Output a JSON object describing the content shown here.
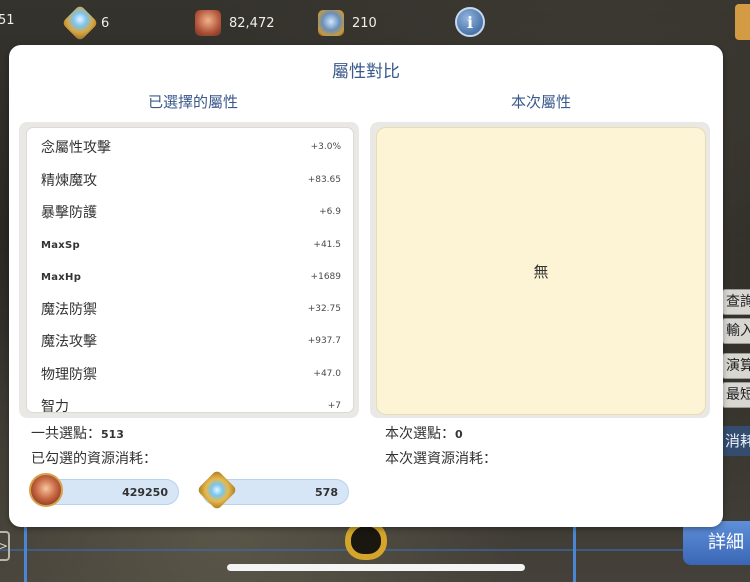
{
  "hud": {
    "partial_left": "51",
    "crystal_count": "6",
    "medal_count": "82,472",
    "lock_count": "210",
    "info_symbol": "i"
  },
  "side": {
    "stub1": "查詢",
    "stub2": "輸入",
    "stub3": "演算",
    "stub4": "最短",
    "consume": "消耗",
    "detail_button": "詳細"
  },
  "dialog": {
    "title": "屬性對比",
    "left_header": "已選擇的屬性",
    "right_header": "本次屬性",
    "selected_attributes": [
      {
        "name": "念屬性攻擊",
        "value": "+3.0%"
      },
      {
        "name": "精煉魔攻",
        "value": "+83.65"
      },
      {
        "name": "暴擊防護",
        "value": "+6.9"
      },
      {
        "name": "MaxSp",
        "value": "+41.5"
      },
      {
        "name": "MaxHp",
        "value": "+1689"
      },
      {
        "name": "魔法防禦",
        "value": "+32.75"
      },
      {
        "name": "魔法攻擊",
        "value": "+937.7"
      },
      {
        "name": "物理防禦",
        "value": "+47.0"
      },
      {
        "name": "智力",
        "value": "+7"
      }
    ],
    "current_empty_text": "無",
    "total_points_label": "一共選點：",
    "total_points_value": "513",
    "selected_cost_label": "已勾選的資源消耗：",
    "current_points_label": "本次選點：",
    "current_points_value": "0",
    "current_cost_label": "本次選資源消耗：",
    "costs": [
      {
        "icon": "medal-icon",
        "amount": "429250"
      },
      {
        "icon": "crystal-icon",
        "amount": "578"
      }
    ]
  }
}
